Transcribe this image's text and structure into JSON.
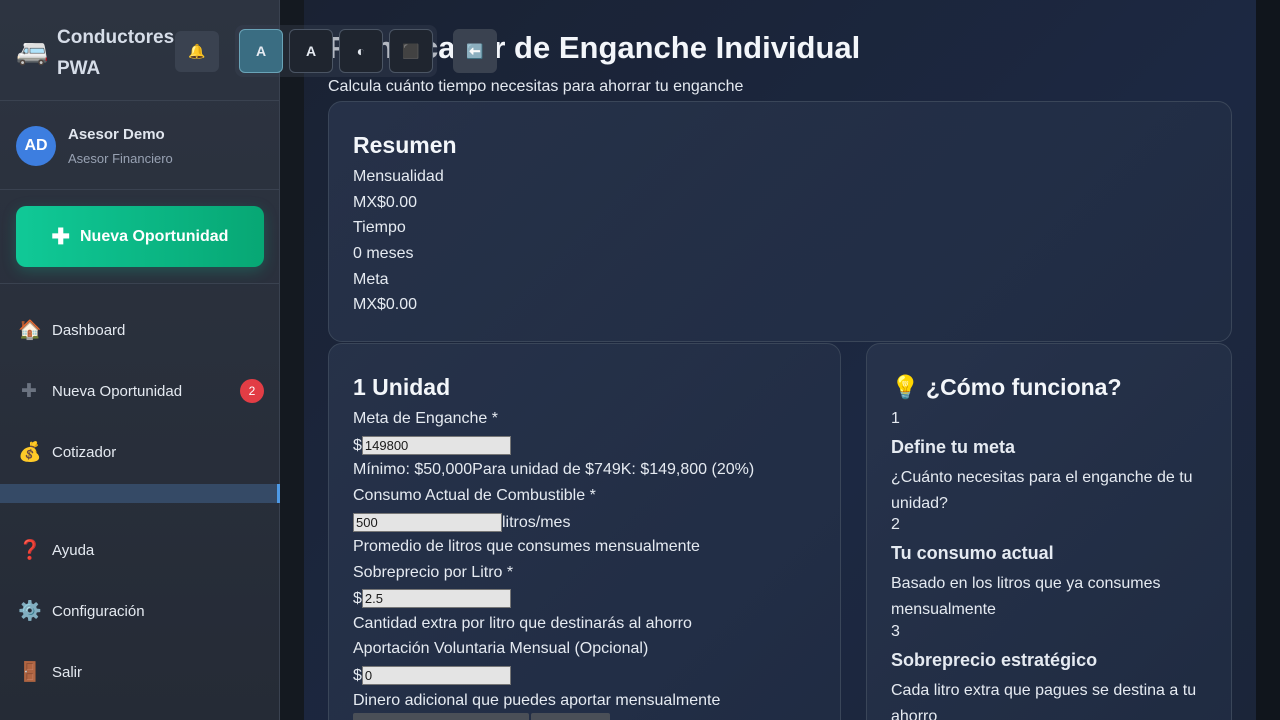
{
  "brand": {
    "icon": "🚐",
    "title": "Conductores PWA"
  },
  "user": {
    "initials": "AD",
    "name": "Asesor Demo",
    "role": "Asesor Financiero"
  },
  "cta": {
    "icon": "✚",
    "label": "Nueva Oportunidad"
  },
  "nav": {
    "dashboard": {
      "icon": "🏠",
      "label": "Dashboard"
    },
    "nueva": {
      "icon": "✚",
      "label": "Nueva Oportunidad",
      "badge": "2"
    },
    "cotizador": {
      "icon": "💰",
      "label": "Cotizador"
    },
    "ayuda": {
      "icon": "❓",
      "label": "Ayuda"
    },
    "config": {
      "icon": "⚙️",
      "label": "Configuración"
    },
    "salir": {
      "icon": "🚪",
      "label": "Salir"
    }
  },
  "toolbar": {
    "bell": "🔔",
    "font_a1": "A",
    "font_a2": "A",
    "contrast": "◐",
    "theme": "⬛",
    "back": "⬅️"
  },
  "page": {
    "title": "Planificador de Enganche Individual",
    "subtitle": "Calcula cuánto tiempo necesitas para ahorrar tu enganche"
  },
  "summary": {
    "title": "Resumen",
    "mensualidad_label": "Mensualidad",
    "mensualidad_value": "MX$0.00",
    "tiempo_label": "Tiempo",
    "tiempo_value": "0 meses",
    "meta_label": "Meta",
    "meta_value": "MX$0.00"
  },
  "form": {
    "title": "1 Unidad",
    "meta_label": "Meta de Enganche *",
    "meta_prefix": "$",
    "meta_value": "149800",
    "meta_hint": "Mínimo: $50,000Para unidad de $749K: $149,800 (20%)",
    "consumo_label": "Consumo Actual de Combustible *",
    "consumo_value": "500",
    "consumo_suffix": "litros/mes",
    "consumo_hint": "Promedio de litros que consumes mensualmente",
    "sobreprecio_label": "Sobreprecio por Litro *",
    "sobreprecio_prefix": "$",
    "sobreprecio_value": "2.5",
    "sobreprecio_hint": "Cantidad extra por litro que destinarás al ahorro",
    "aportacion_label": "Aportación Voluntaria Mensual (Opcional)",
    "aportacion_prefix": "$",
    "aportacion_value": "0",
    "aportacion_hint": "Dinero adicional que puedes aportar mensualmente"
  },
  "how": {
    "title": "💡 ¿Cómo funciona?",
    "steps": [
      {
        "n": "1",
        "title": "Define tu meta",
        "desc": "¿Cuánto necesitas para el enganche de tu unidad?"
      },
      {
        "n": "2",
        "title": "Tu consumo actual",
        "desc": "Basado en los litros que ya consumes mensualmente"
      },
      {
        "n": "3",
        "title": "Sobreprecio estratégico",
        "desc": "Cada litro extra que pagues se destina a tu ahorro"
      }
    ]
  },
  "colors": {
    "accent_green": "#10c997",
    "badge_red": "#e23d45",
    "avatar_blue": "#3d7ee0"
  }
}
